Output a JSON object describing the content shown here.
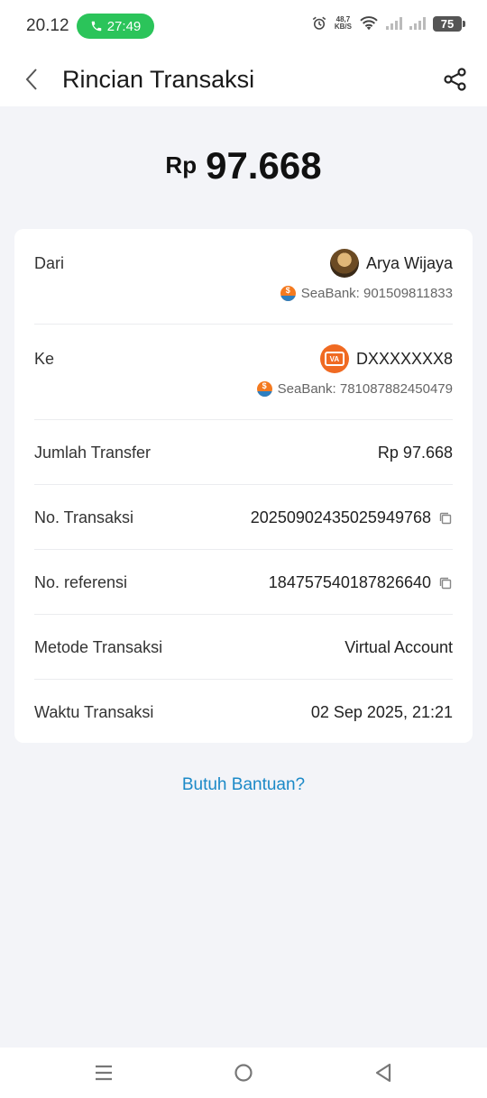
{
  "status_bar": {
    "time": "20.12",
    "call_timer": "27:49",
    "net_speed_value": "48,7",
    "net_speed_unit": "KB/S",
    "battery": "75"
  },
  "header": {
    "title": "Rincian Transaksi"
  },
  "amount": {
    "currency": "Rp",
    "value": "97.668"
  },
  "details": {
    "from": {
      "label": "Dari",
      "name": "Arya Wijaya",
      "account": "SeaBank: 901509811833"
    },
    "to": {
      "label": "Ke",
      "name": "DXXXXXXX8",
      "account": "SeaBank: 781087882450479"
    },
    "amount": {
      "label": "Jumlah Transfer",
      "value": "Rp 97.668"
    },
    "transaction_no": {
      "label": "No. Transaksi",
      "value": "20250902435025949768"
    },
    "reference_no": {
      "label": "No. referensi",
      "value": "184757540187826640"
    },
    "method": {
      "label": "Metode Transaksi",
      "value": "Virtual Account"
    },
    "time": {
      "label": "Waktu Transaksi",
      "value": "02 Sep 2025, 21:21"
    }
  },
  "help_link": "Butuh Bantuan?",
  "icons": {
    "va_badge": "VA"
  },
  "colors": {
    "accent_link": "#1b89c7",
    "call_green": "#2bc45a",
    "brand_orange": "#f06a22"
  }
}
